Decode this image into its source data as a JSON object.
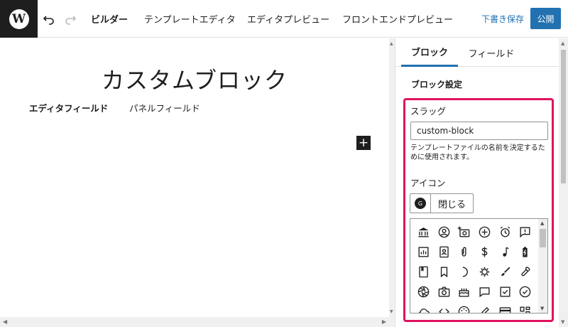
{
  "topbar": {
    "logo": "W",
    "nav": [
      "ビルダー",
      "テンプレートエディタ",
      "エディタプレビュー",
      "フロントエンドプレビュー"
    ],
    "draft_save": "下書き保存",
    "publish": "公開"
  },
  "canvas": {
    "title": "カスタムブロック",
    "tabs": [
      "エディタフィールド",
      "パネルフィールド"
    ],
    "add_symbol": "+"
  },
  "sidebar": {
    "tabs": [
      "ブロック",
      "フィールド"
    ],
    "section_title": "ブロック設定",
    "slug_label": "スラッグ",
    "slug_value": "custom-block",
    "slug_help": "テンプレートファイルの名前を決定するために使用されます。",
    "icon_label": "アイコン",
    "icon_preview_letter": "G",
    "close_label": "閉じる"
  },
  "icons": [
    "bank-icon",
    "user-circle-icon",
    "camera-add-icon",
    "plus-circle-icon",
    "alarm-icon",
    "feedback-icon",
    "chart-icon",
    "contact-card-icon",
    "paperclip-icon",
    "dollar-icon",
    "music-note-icon",
    "battery-charging-icon",
    "book-icon",
    "bookmark-icon",
    "moon-icon",
    "sun-icon",
    "brush-icon",
    "wrench-icon",
    "camera-aperture-icon",
    "camera-icon",
    "cake-icon",
    "chat-bubble-icon",
    "checkbox-icon",
    "check-circle-icon",
    "cloud-icon",
    "code-icon",
    "palette-icon",
    "pencil-icon",
    "credit-card-icon",
    "dashboard-icon"
  ],
  "colors": {
    "accent": "#2271b1",
    "highlight": "#e0115f",
    "dark": "#1e1e1e"
  }
}
